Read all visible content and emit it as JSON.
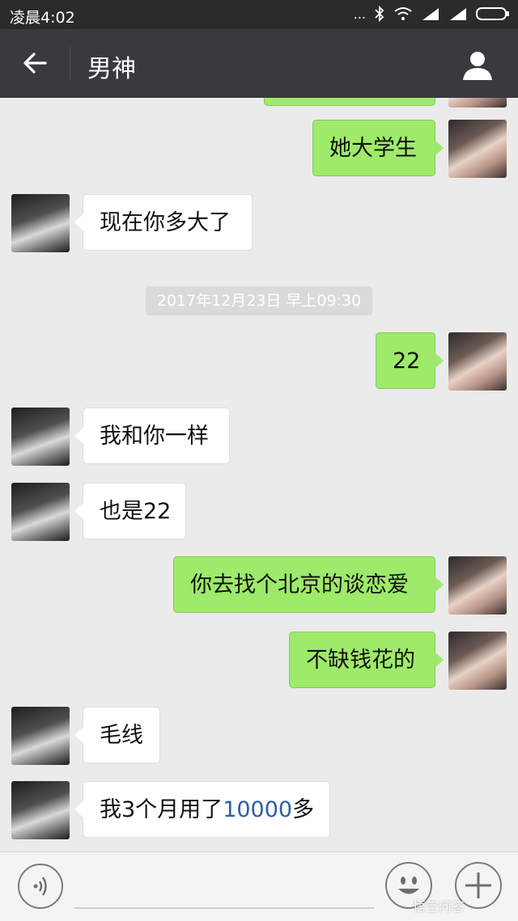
{
  "status_bar": {
    "time": "凌晨4:02",
    "signal_text": "..."
  },
  "header": {
    "title": "男神"
  },
  "timestamp": "2017年12月23日 早上09:30",
  "messages": [
    {
      "side": "right",
      "text": "她大学生"
    },
    {
      "side": "left",
      "text": "现在你多大了"
    },
    {
      "side": "right",
      "text": "22"
    },
    {
      "side": "left",
      "text": "我和你一样"
    },
    {
      "side": "left",
      "text": "也是22"
    },
    {
      "side": "right",
      "text": "你去找个北京的谈恋爱"
    },
    {
      "side": "right",
      "text": "不缺钱花的"
    },
    {
      "side": "left",
      "text": "毛线"
    },
    {
      "side": "left",
      "text_before": "我3个月用了",
      "text_highlight": "10000",
      "text_after": "多"
    }
  ],
  "watermark": "悟空问答",
  "colors": {
    "title_bar": "#393a3f",
    "sent_bubble": "#9eea6a",
    "received_bubble": "#ffffff",
    "chat_bg": "#ebebeb",
    "highlight_text": "#2b5fa8"
  }
}
